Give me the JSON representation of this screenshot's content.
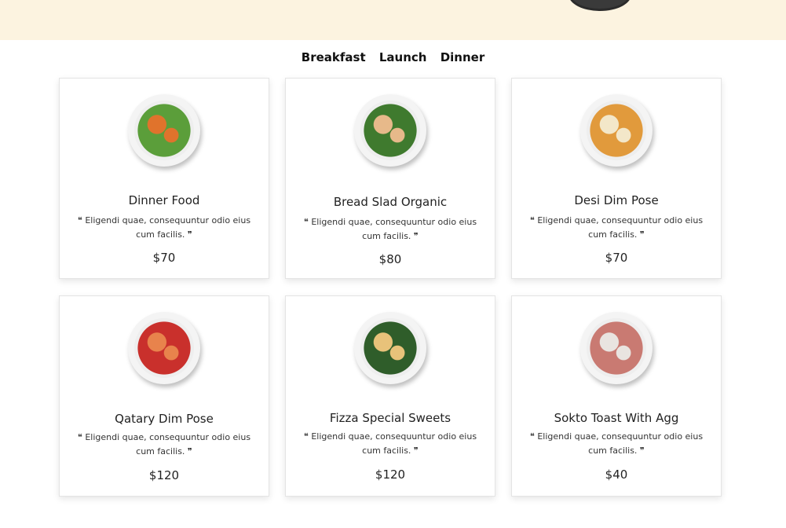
{
  "tabs": [
    "Breakfast",
    "Launch",
    "Dinner"
  ],
  "menu_items": [
    {
      "title": "Dinner Food",
      "description": "❝ Eligendi quae, consequuntur odio eius cum facilis. ❞",
      "price": "$70",
      "colors": [
        "#5b9e3a",
        "#e0732c"
      ]
    },
    {
      "title": "Bread Slad Organic",
      "description": "❝ Eligendi quae, consequuntur odio eius cum facilis. ❞",
      "price": "$80",
      "colors": [
        "#3f7a2e",
        "#e7b98a"
      ]
    },
    {
      "title": "Desi Dim Pose",
      "description": "❝ Eligendi quae, consequuntur odio eius cum facilis. ❞",
      "price": "$70",
      "colors": [
        "#e19a3c",
        "#f3e7c9"
      ]
    },
    {
      "title": "Qatary Dim Pose",
      "description": "❝ Eligendi quae, consequuntur odio eius cum facilis. ❞",
      "price": "$120",
      "colors": [
        "#c9302c",
        "#e8834c"
      ]
    },
    {
      "title": "Fizza Special Sweets",
      "description": "❝ Eligendi quae, consequuntur odio eius cum facilis. ❞",
      "price": "$120",
      "colors": [
        "#2f5d2a",
        "#e8c27a"
      ]
    },
    {
      "title": "Sokto Toast With Agg",
      "description": "❝ Eligendi quae, consequuntur odio eius cum facilis. ❞",
      "price": "$40",
      "colors": [
        "#c97a72",
        "#e9e4e0"
      ]
    }
  ]
}
